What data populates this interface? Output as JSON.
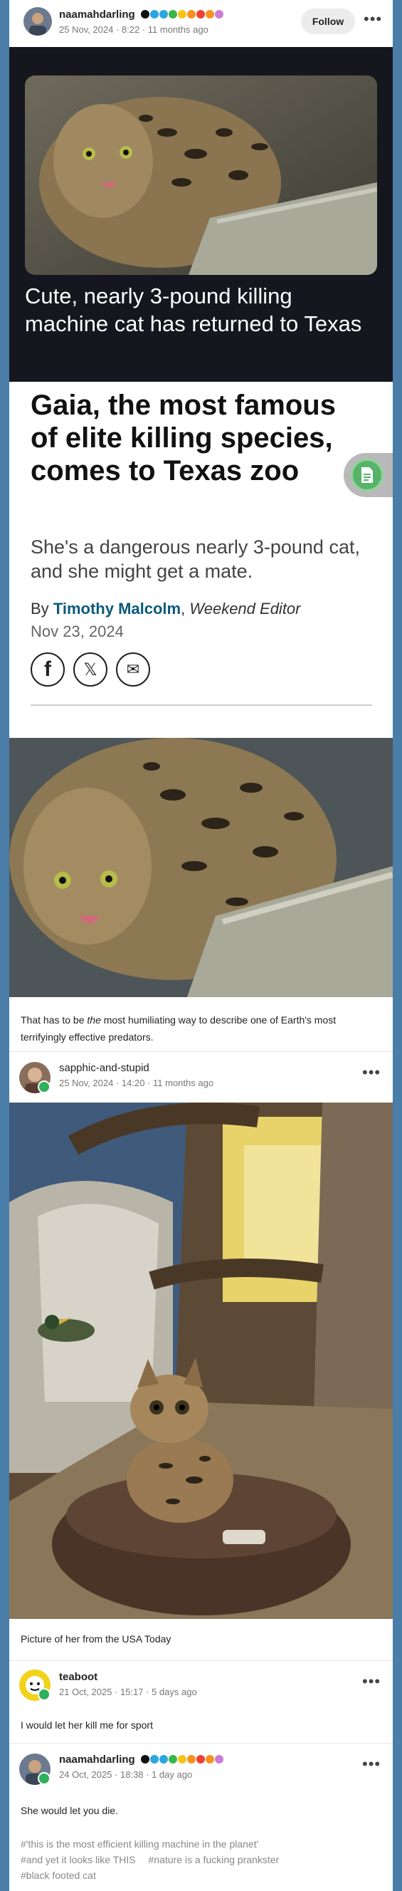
{
  "op": {
    "username": "naamahdarling",
    "timestamp": "25 Nov, 2024 · 8:22 · 11 months ago",
    "follow_label": "Follow",
    "more_label": "•••",
    "badge_colors": [
      "#111111",
      "#2aa7e0",
      "#2aa7e0",
      "#39b54a",
      "#f7c31a",
      "#f7931e",
      "#ef4136",
      "#f7931e",
      "#cc7cd6"
    ]
  },
  "link_card": {
    "headline": "Cute, nearly 3-pound killing machine cat has returned to Texas"
  },
  "article": {
    "title": "Gaia, the most famous of elite killing species, comes to Texas zoo",
    "subtitle": "She's a dangerous nearly 3-pound cat, and she might get a mate.",
    "by": "By",
    "author": "Timothy Malcolm",
    "comma": ",",
    "role": "Weekend Editor",
    "date": "Nov 23, 2024",
    "share_facebook": "f",
    "share_x": "𝕏",
    "share_email": "✉"
  },
  "caption1": {
    "text_before": "That has to be ",
    "text_em": "the",
    "text_after": " most humiliating way to describe one of Earth's most terrifyingly effective predators."
  },
  "reblog": {
    "username": "sapphic-and-stupid",
    "timestamp": "25 Nov, 2024 · 14:20 · 11 months ago",
    "more_label": "•••",
    "caption": "Picture of her from the USA Today"
  },
  "reply1": {
    "username": "teaboot",
    "timestamp": "21 Oct, 2025 · 15:17 · 5 days ago",
    "more_label": "•••",
    "text": "I would let her kill me for sport"
  },
  "reply2": {
    "username": "naamahdarling",
    "timestamp": "24 Oct, 2025 · 18:38 · 1 day ago",
    "more_label": "•••",
    "text": "She would let you die.",
    "tags": [
      "#'this is the most efficient killing machine in the planet'",
      "#and yet it looks like THIS",
      "#nature is a fucking prankster",
      "#black footed cat"
    ]
  }
}
